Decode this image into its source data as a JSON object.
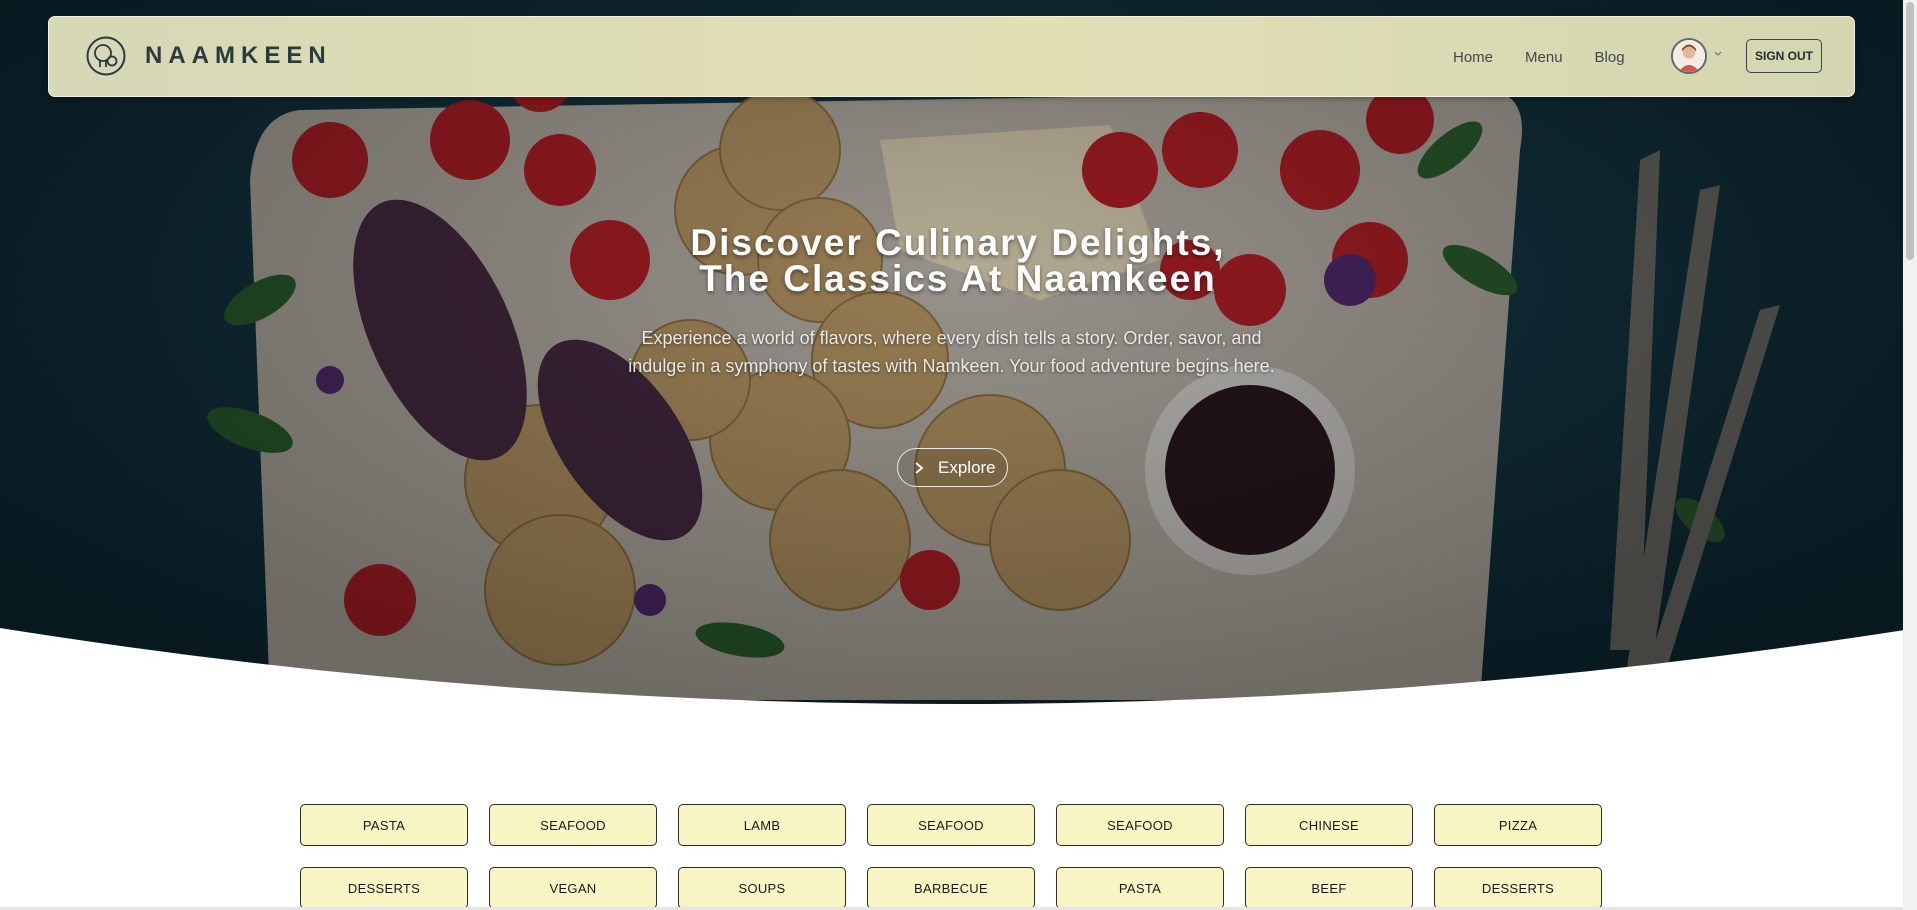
{
  "brand": {
    "name": "NAAMKEEN",
    "logo_icon": "bulb-logo-icon"
  },
  "nav": {
    "links": [
      "Home",
      "Menu",
      "Blog"
    ],
    "avatar_icon": "user-avatar-icon",
    "signout_label": "SIGN OUT"
  },
  "hero": {
    "title_line1": "Discover Culinary Delights,",
    "title_line2": "The Classics At Naamkeen",
    "subtitle": "Experience a world of flavors, where every dish tells a story. Order, savor, and indulge in a symphony of tastes with Namkeen. Your food adventure begins here.",
    "explore_label": "Explore",
    "explore_icon": "chevron-right-icon"
  },
  "categories": [
    "PASTA",
    "SEAFOOD",
    "LAMB",
    "SEAFOOD",
    "SEAFOOD",
    "CHINESE",
    "PIZZA",
    "DESSERTS",
    "VEGAN",
    "SOUPS",
    "BARBECUE",
    "PASTA",
    "BEEF",
    "DESSERTS"
  ],
  "colors": {
    "navbar_bg": "#dcdcb5",
    "category_pill_bg": "#f8f4c4",
    "hero_bg": "#16394a",
    "text_dark": "#2b3a3f"
  }
}
